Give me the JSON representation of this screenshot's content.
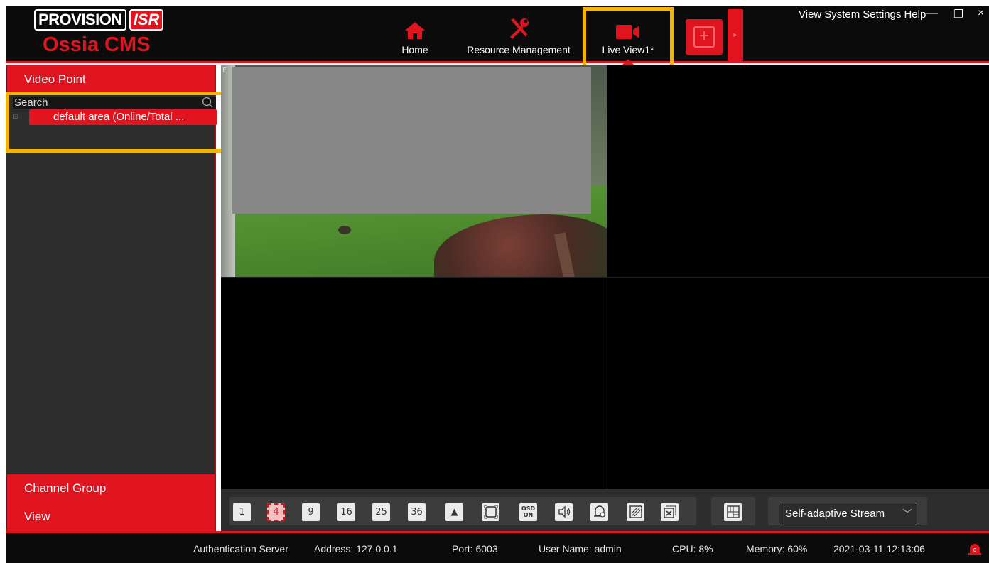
{
  "logo": {
    "brand": "PROVISION",
    "brand_suffix": "ISR",
    "product": "Ossia CMS"
  },
  "nav": {
    "home": "Home",
    "resource": "Resource Management",
    "live": "Live View1*"
  },
  "menu": {
    "view": "View",
    "system": "System",
    "settings": "Settings",
    "help": "Help"
  },
  "window_controls": {
    "minimize": "—",
    "restore": "❐",
    "close": "×"
  },
  "left_panel": {
    "header": "Video Point",
    "search_placeholder": "Search",
    "tree_expand": "⊞",
    "tree_item": "default area (Online/Total ...",
    "footer_items": [
      "Channel Group",
      "View"
    ]
  },
  "video": {
    "cam1_label": "E"
  },
  "toolbar": {
    "layouts": [
      "1",
      "4",
      "9",
      "16",
      "25",
      "36"
    ],
    "active_layout": "4",
    "osd_top": "OSD",
    "osd_bottom": "ON",
    "stream": "Self-adaptive Stream"
  },
  "status": {
    "auth": "Authentication Server",
    "address": "Address: 127.0.0.1",
    "port": "Port: 6003",
    "user": "User Name: admin",
    "cpu": "CPU: 8%",
    "memory": "Memory: 60%",
    "datetime": "2021-03-11 12:13:06",
    "alarm_count": "0"
  },
  "colors": {
    "accent": "#e0141f",
    "highlight": "#f5b400",
    "panel": "#2d2d2d",
    "bar": "#0b0b0b"
  }
}
